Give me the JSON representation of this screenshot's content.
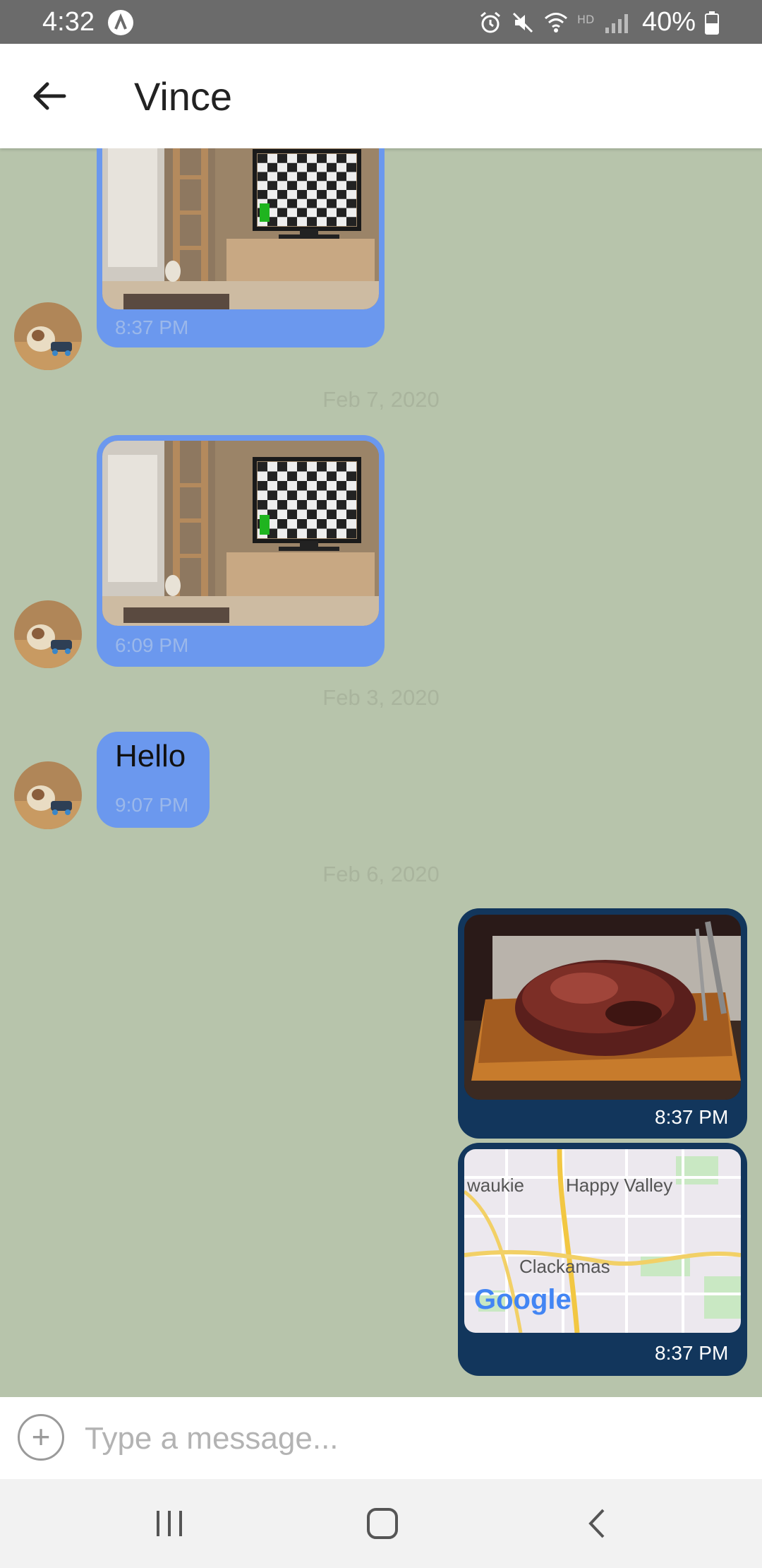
{
  "status_bar": {
    "time": "4:32",
    "battery": "40%"
  },
  "header": {
    "title": "Vince"
  },
  "messages": {
    "m1_time": "8:37 PM",
    "date1": "Feb 7, 2020",
    "m2_time": "6:09 PM",
    "date2": "Feb 3, 2020",
    "m3_text": "Hello",
    "m3_time": "9:07 PM",
    "date3": "Feb 6, 2020",
    "m4_time": "8:37 PM",
    "m5_time": "8:37 PM"
  },
  "map": {
    "label1": "waukie",
    "label2": "Happy Valley",
    "label3": "Clackamas",
    "brand": "Google"
  },
  "composer": {
    "placeholder": "Type a message..."
  },
  "colors": {
    "incoming_bubble": "#6b98ee",
    "outgoing_bubble": "#12365c",
    "chat_background": "#b7c4ab"
  }
}
